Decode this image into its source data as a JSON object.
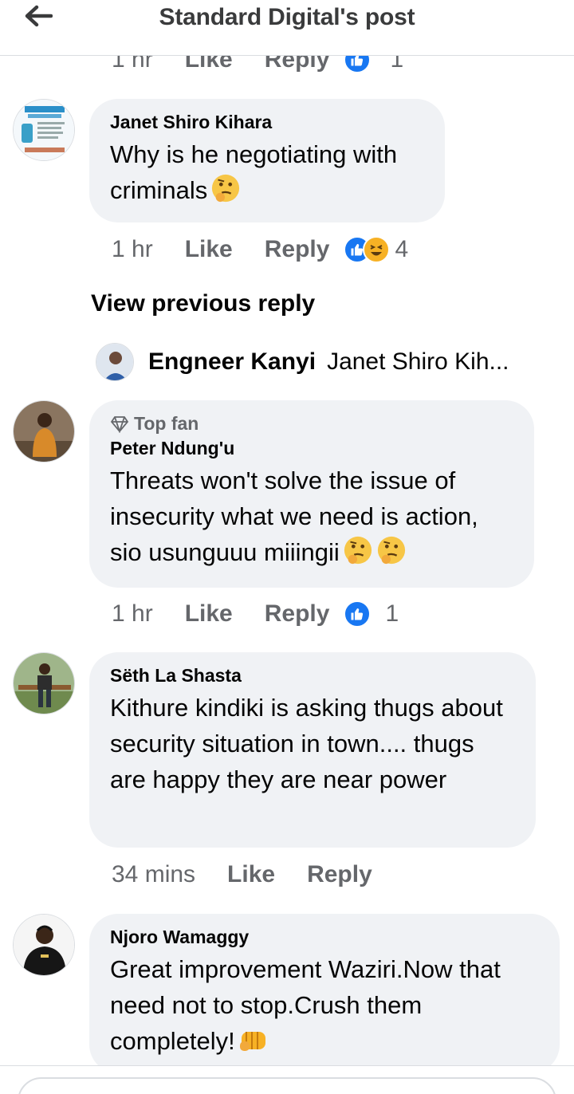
{
  "header": {
    "title": "Standard Digital's post"
  },
  "top_partial": {
    "time": "1 hr",
    "like": "Like",
    "reply": "Reply",
    "count": "1"
  },
  "comments": [
    {
      "author": "Janet Shiro Kihara",
      "text": "Why is he negotiating with criminals",
      "emoji": "thinking-face",
      "time": "1 hr",
      "like": "Like",
      "reply": "Reply",
      "count": "4",
      "reactions": [
        "like",
        "haha"
      ]
    },
    {
      "badge": "Top fan",
      "author": "Peter Ndung'u",
      "text": "Threats won't solve the issue of insecurity what we need is action, sio usunguuu miiingii",
      "emoji": "thinking-face",
      "time": "1 hr",
      "like": "Like",
      "reply": "Reply",
      "count": "1",
      "reactions": [
        "like"
      ]
    },
    {
      "author": "Sëth La Shasta",
      "text": "Kithure kindiki is asking thugs about security situation in town.... thugs are happy they are near power",
      "time": "34 mins",
      "like": "Like",
      "reply": "Reply"
    },
    {
      "author": "Njoro Wamaggy",
      "text": "Great improvement Waziri.Now that need not to stop.Crush them completely!",
      "emoji": "oncoming-fist"
    }
  ],
  "view_previous": "View previous reply",
  "reply_preview": {
    "author": "Engneer Kanyi",
    "text": "Janet Shiro Kih..."
  },
  "colors": {
    "bubble": "#f0f2f5",
    "like_blue": "#1877f2",
    "haha_yellow": "#f7b125",
    "meta_grey": "#65676b"
  }
}
